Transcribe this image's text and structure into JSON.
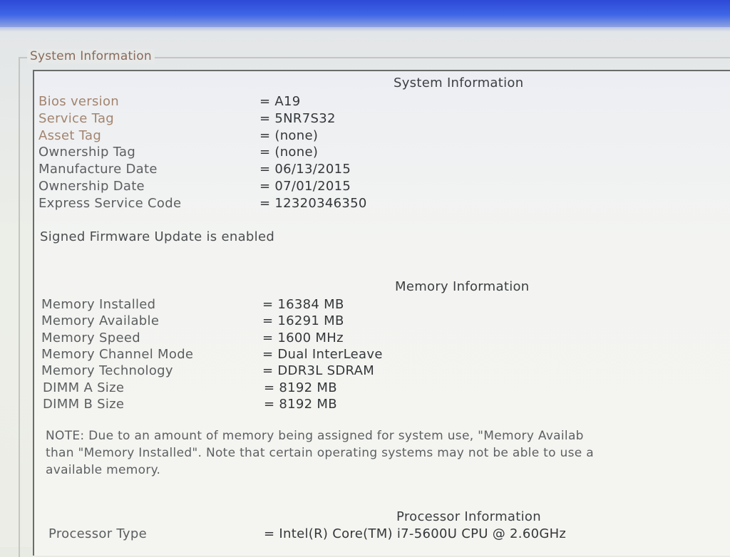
{
  "group_title": "System Information",
  "system": {
    "title": "System Information",
    "rows": [
      {
        "label": "Bios version",
        "value": "A19"
      },
      {
        "label": "Service Tag",
        "value": "5NR7S32"
      },
      {
        "label": "Asset Tag",
        "value": "(none)"
      },
      {
        "label": "Ownership Tag",
        "value": "(none)"
      },
      {
        "label": "Manufacture Date",
        "value": "06/13/2015"
      },
      {
        "label": "Ownership Date",
        "value": "07/01/2015"
      },
      {
        "label": "Express Service Code",
        "value": "12320346350"
      }
    ],
    "firmware_status": "Signed Firmware Update is enabled"
  },
  "memory": {
    "title": "Memory Information",
    "rows": [
      {
        "label": "Memory Installed",
        "value": "16384 MB"
      },
      {
        "label": "Memory Available",
        "value": "16291 MB"
      },
      {
        "label": "Memory Speed",
        "value": "1600 MHz"
      },
      {
        "label": "Memory Channel Mode",
        "value": "Dual InterLeave"
      },
      {
        "label": "Memory Technology",
        "value": "DDR3L SDRAM"
      },
      {
        "label": "DIMM A Size",
        "value": "8192 MB"
      },
      {
        "label": "DIMM B Size",
        "value": "8192 MB"
      }
    ],
    "note_lines": [
      "NOTE: Due to an amount of memory being assigned for system use, \"Memory Availab",
      "than \"Memory Installed\". Note that certain operating systems may not be able to use a",
      "available memory."
    ]
  },
  "processor": {
    "title": "Processor Information",
    "rows": [
      {
        "label": "Processor Type",
        "value": "Intel(R) Core(TM) i7-5600U CPU @ 2.60GHz"
      }
    ]
  },
  "equals_sign": "=",
  "colors": {
    "title_bar": "#3e66e6",
    "panel_bg": "#f3f4f1",
    "label_muted": "#a3846e",
    "label_text": "#5b5e60",
    "value_text": "#34373a"
  }
}
